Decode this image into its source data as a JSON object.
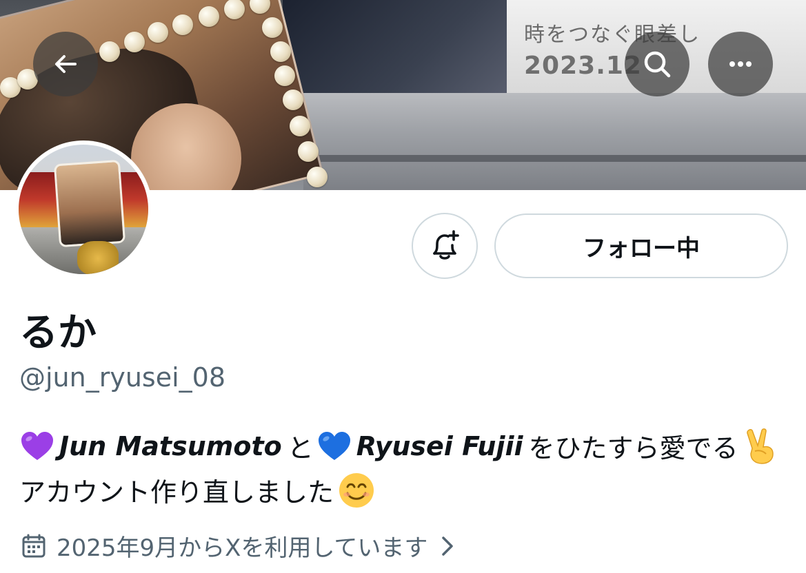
{
  "header": {
    "back_icon": "arrow-left-icon",
    "search_icon": "search-icon",
    "more_icon": "more-horizontal-icon",
    "banner_text_line1": "時をつなぐ眼差し",
    "banner_text_line2": "2023.12"
  },
  "profile": {
    "display_name": "るか",
    "handle": "@jun_ryusei_08",
    "notify_icon": "bell-plus-icon",
    "follow_label": "フォロー中"
  },
  "bio": {
    "heart1_icon": "purple-heart-emoji",
    "name1": "Jun Matsumoto",
    "connector": "と",
    "heart2_icon": "blue-heart-emoji",
    "name2": "Ryusei Fujii",
    "phrase": "をひたすら愛でる",
    "victory_icon": "victory-hand-emoji",
    "line2": "アカウント作り直しました",
    "smile_icon": "smiling-face-emoji"
  },
  "joined": {
    "calendar_icon": "calendar-icon",
    "text": "2025年9月からXを利用しています",
    "chevron_icon": "chevron-right-icon"
  },
  "colors": {
    "text_primary": "#0f1419",
    "text_secondary": "#536471",
    "border": "#cfd9de",
    "purple_heart": "#9b3fe6",
    "blue_heart": "#1d6fe0"
  }
}
